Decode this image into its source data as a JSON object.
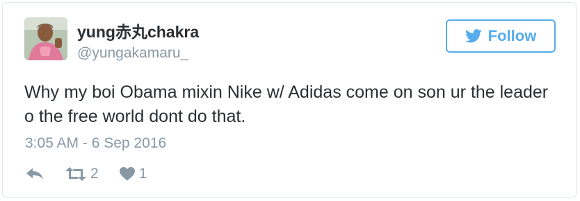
{
  "user": {
    "display_name": "yung赤丸chakra",
    "handle": "@yungakamaru_"
  },
  "follow_button": {
    "label": "Follow",
    "icon": "twitter-bird-icon"
  },
  "tweet": {
    "text": "Why my boi Obama mixin Nike w/ Adidas come on son ur the leader o the free world dont do that.",
    "timestamp": "3:05 AM - 6 Sep 2016"
  },
  "actions": {
    "reply_icon": "reply-icon",
    "retweet_icon": "retweet-icon",
    "retweet_count": "2",
    "like_icon": "heart-icon",
    "like_count": "1"
  },
  "colors": {
    "accent": "#55acee",
    "text": "#292f33",
    "muted": "#8899a6",
    "border": "#e1e8ed"
  }
}
